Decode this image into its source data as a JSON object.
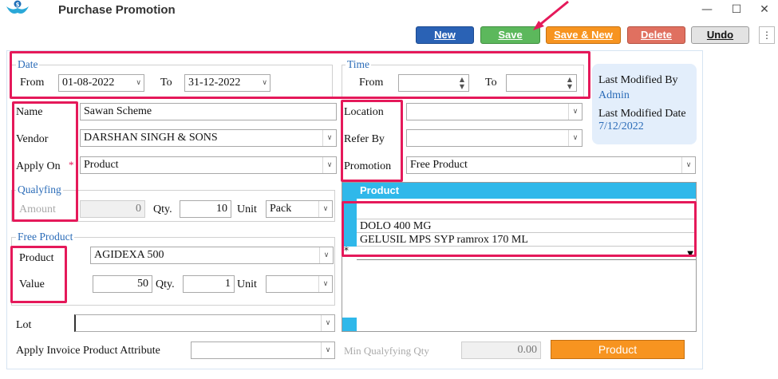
{
  "window": {
    "title": "Purchase Promotion"
  },
  "toolbar": {
    "new_label": "New",
    "save_label": "Save",
    "save_new_label": "Save & New",
    "delete_label": "Delete",
    "undo_label": "Undo",
    "colors": {
      "new": "#2a62b5",
      "save": "#5cb85c",
      "save_new": "#f79420",
      "delete": "#e07060",
      "undo": "#e3e3e3"
    }
  },
  "date_group": {
    "legend": "Date",
    "from_label": "From",
    "from_value": "01-08-2022",
    "to_label": "To",
    "to_value": "31-12-2022"
  },
  "time_group": {
    "legend": "Time",
    "from_label": "From",
    "from_value": "",
    "to_label": "To",
    "to_value": ""
  },
  "info": {
    "modified_by_label": "Last Modified By",
    "modified_by_value": "Admin",
    "modified_date_label": "Last Modified Date",
    "modified_date_value": "7/12/2022"
  },
  "left_form": {
    "name_label": "Name",
    "name_value": "Sawan Scheme",
    "vendor_label": "Vendor",
    "vendor_value": "DARSHAN SINGH & SONS",
    "apply_on_label": "Apply On",
    "required_mark": "*",
    "apply_on_value": "Product",
    "qualifying_legend": "Qualyfing",
    "amount_label": "Amount",
    "amount_value": "0",
    "qty_label": "Qty.",
    "qty_value": "10",
    "unit_label": "Unit",
    "unit_value": "Pack"
  },
  "right_form": {
    "location_label": "Location",
    "location_value": "",
    "refer_by_label": "Refer By",
    "refer_by_value": "",
    "promotion_label": "Promotion",
    "promotion_value": "Free Product"
  },
  "free_product": {
    "legend": "Free Product",
    "product_label": "Product",
    "product_value": "AGIDEXA 500",
    "value_label": "Value",
    "value_value": "50",
    "qty_label": "Qty.",
    "qty_value": "1",
    "unit_label": "Unit",
    "unit_value": ""
  },
  "grid": {
    "header": "Product",
    "rows": [
      "",
      "DOLO 400 MG",
      "GELUSIL MPS SYP ramrox 170 ML"
    ],
    "new_row_marker": "*"
  },
  "bottom": {
    "lot_label": "Lot",
    "lot_value": "",
    "apply_attr_label": "Apply Invoice Product Attribute",
    "apply_attr_value": "",
    "min_qty_label": "Min Qualyfying Qty",
    "min_qty_value": "0.00",
    "product_button_label": "Product"
  },
  "highlight_color": "#e5195a"
}
